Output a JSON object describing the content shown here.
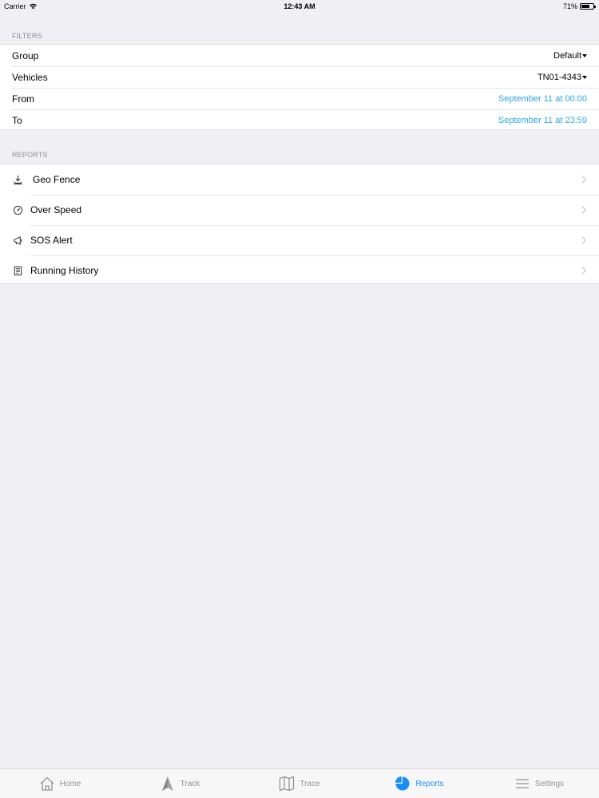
{
  "status_bar": {
    "carrier": "Carrier",
    "time": "12:43 AM",
    "battery": "71%",
    "battery_level": 0.71
  },
  "filters": {
    "header": "FILTERS",
    "rows": [
      {
        "label": "Group",
        "value": "Default",
        "kind": "dropdown"
      },
      {
        "label": "Vehicles",
        "value": "TN01-4343",
        "kind": "dropdown"
      },
      {
        "label": "From",
        "value": "September 11 at 00:00",
        "kind": "date"
      },
      {
        "label": "To",
        "value": "September 11 at 23:59",
        "kind": "date"
      }
    ]
  },
  "reports": {
    "header": "REPORTS",
    "items": [
      {
        "label": "Geo Fence",
        "icon": "geofence-icon"
      },
      {
        "label": "Over Speed",
        "icon": "speedometer-icon"
      },
      {
        "label": "SOS Alert",
        "icon": "megaphone-icon"
      },
      {
        "label": "Running History",
        "icon": "document-icon"
      }
    ]
  },
  "tab_bar": {
    "tabs": [
      {
        "label": "Home",
        "icon": "home-icon",
        "active": false
      },
      {
        "label": "Track",
        "icon": "navigation-arrow-icon",
        "active": false
      },
      {
        "label": "Trace",
        "icon": "map-icon",
        "active": false
      },
      {
        "label": "Reports",
        "icon": "pie-chart-icon",
        "active": true
      },
      {
        "label": "Settings",
        "icon": "menu-lines-icon",
        "active": false
      }
    ]
  },
  "colors": {
    "accent": "#1a8ef7",
    "link": "#2ea8e0",
    "background": "#efeff4",
    "inactive": "#929292"
  }
}
